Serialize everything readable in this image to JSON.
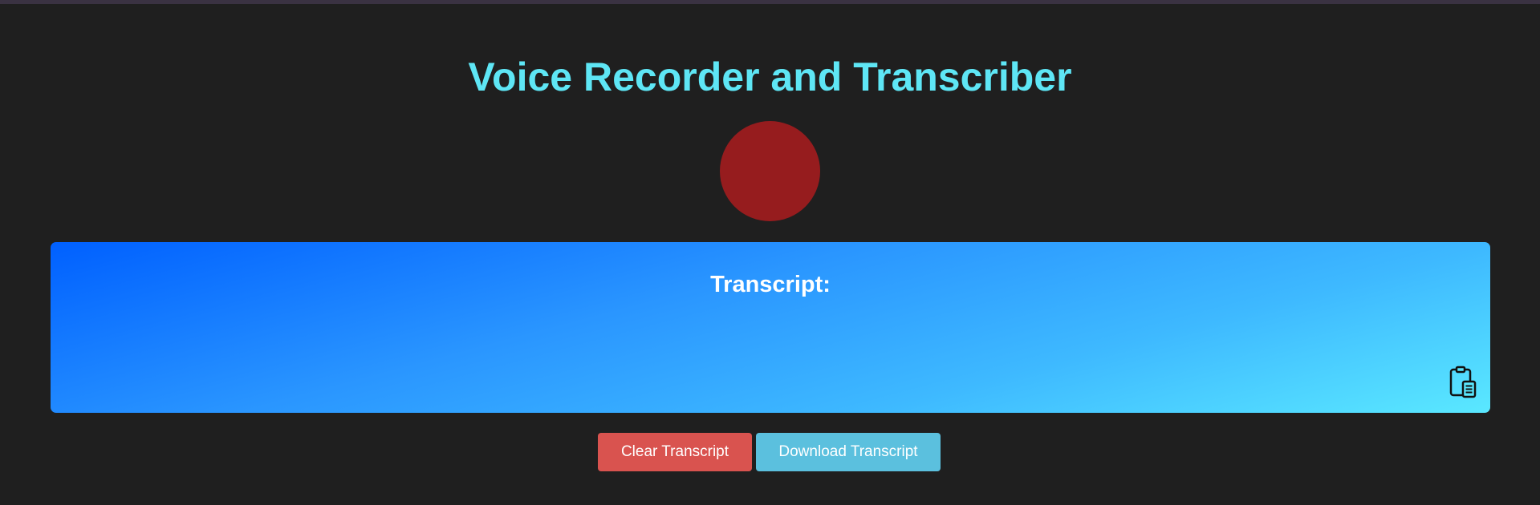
{
  "app": {
    "title": "Voice Recorder and Transcriber"
  },
  "recorder": {
    "record_button_color": "#961c1e"
  },
  "transcript": {
    "heading": "Transcript:",
    "text": "",
    "copy_icon": "clipboard-icon",
    "gradient_start": "#0060ff",
    "gradient_end": "#5ae8ff"
  },
  "actions": {
    "clear_label": "Clear Transcript",
    "download_label": "Download Transcript",
    "clear_color": "#d9534f",
    "download_color": "#5bc0de"
  },
  "theme": {
    "background": "#1f1f1f",
    "title_color": "#5ee6f5"
  }
}
